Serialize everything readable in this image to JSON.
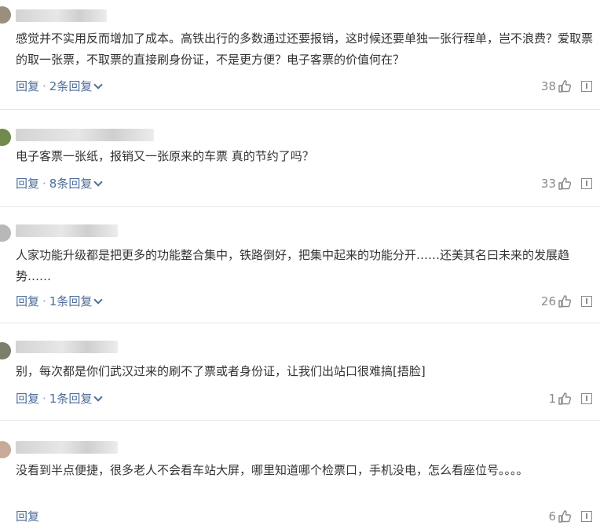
{
  "comments": [
    {
      "text": "感觉并不实用反而增加了成本。高铁出行的多数通过还要报销，这时候还要单独一张行程单，岂不浪费？爱取票的取一张票，不取票的直接刷身份证，不是更方便？电子客票的价值何在？",
      "reply_label": "回复",
      "sep": "·",
      "replies": "2条回复",
      "likes": "38",
      "avatar_color": "#9a8f7d"
    },
    {
      "text": "电子客票一张纸，报销又一张原来的车票 真的节约了吗？",
      "reply_label": "回复",
      "sep": "·",
      "replies": "8条回复",
      "likes": "33",
      "avatar_color": "#6f8a4a"
    },
    {
      "text": "人家功能升级都是把更多的功能整合集中，铁路倒好，把集中起来的功能分开……还美其名曰未来的发展趋势……",
      "reply_label": "回复",
      "sep": "·",
      "replies": "1条回复",
      "likes": "26",
      "avatar_color": "#b8b8b8"
    },
    {
      "text": "别，每次都是你们武汉过来的刷不了票或者身份证，让我们出站口很难搞[捂脸]",
      "reply_label": "回复",
      "sep": "·",
      "replies": "1条回复",
      "likes": "1",
      "avatar_color": "#7a7f6a"
    },
    {
      "text": "没看到半点便捷，很多老人不会看车站大屏，哪里知道哪个检票口，手机没电，怎么看座位号。。。。",
      "reply_label": "回复",
      "sep": "",
      "replies": "",
      "likes": "6",
      "avatar_color": "#c9a99a"
    }
  ]
}
